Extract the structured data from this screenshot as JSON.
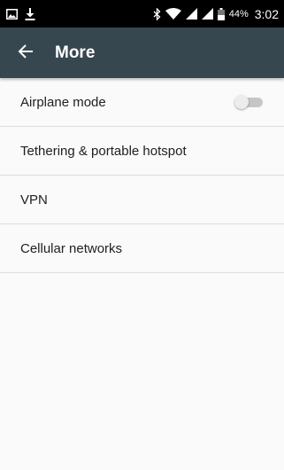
{
  "status_bar": {
    "left_icons": [
      "gallery-icon",
      "download-icon"
    ],
    "right_icons": [
      "bluetooth-icon",
      "wifi-icon",
      "signal-icon",
      "signal-icon",
      "battery-icon"
    ],
    "battery": "44%",
    "time": "3:02"
  },
  "toolbar": {
    "title": "More",
    "back_icon": "back-arrow-icon",
    "background_color": "#37474f"
  },
  "settings": {
    "items": [
      {
        "label": "Airplane mode",
        "toggle": false
      },
      {
        "label": "Tethering & portable hotspot"
      },
      {
        "label": "VPN"
      },
      {
        "label": "Cellular networks"
      }
    ]
  }
}
